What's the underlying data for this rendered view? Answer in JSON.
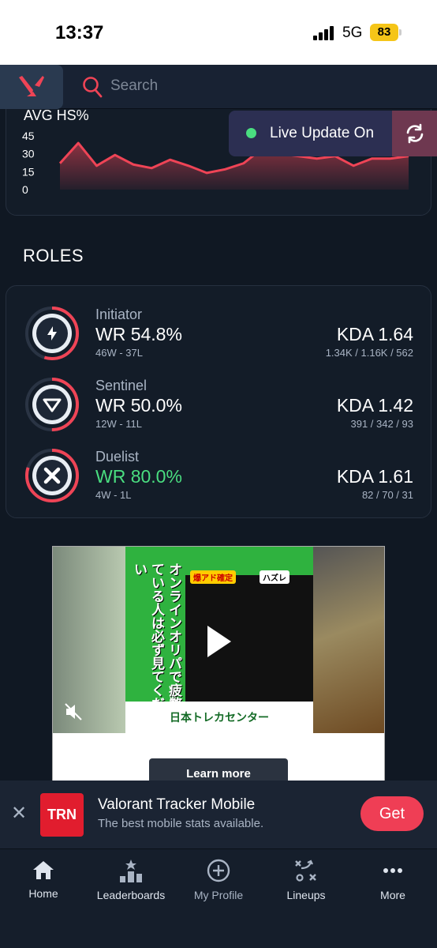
{
  "status_bar": {
    "time": "13:37",
    "network": "5G",
    "battery": "83"
  },
  "header": {
    "search_placeholder": "Search"
  },
  "hs_chart": {
    "title": "AVG HS%",
    "live_update_label": "Live Update On"
  },
  "chart_data": {
    "type": "area",
    "title": "AVG HS%",
    "yticks": [
      45,
      30,
      15,
      0
    ],
    "ylim": [
      0,
      45
    ],
    "values": [
      22,
      39,
      20,
      29,
      21,
      18,
      25,
      20,
      14,
      17,
      22,
      34,
      30,
      28,
      26,
      28,
      20,
      26,
      26,
      28
    ],
    "color": "#ef4456"
  },
  "roles": {
    "heading": "ROLES",
    "items": [
      {
        "name": "Initiator",
        "wr": "WR 54.8%",
        "wl": "46W - 37L",
        "kda": "KDA 1.64",
        "kda_detail": "1.34K / 1.16K / 562",
        "wr_fraction": 0.548,
        "highlight": false
      },
      {
        "name": "Sentinel",
        "wr": "WR 50.0%",
        "wl": "12W - 11L",
        "kda": "KDA 1.42",
        "kda_detail": "391 / 342 / 93",
        "wr_fraction": 0.5,
        "highlight": false
      },
      {
        "name": "Duelist",
        "wr": "WR 80.0%",
        "wl": "4W - 1L",
        "kda": "KDA 1.61",
        "kda_detail": "82 / 70 / 31",
        "wr_fraction": 0.8,
        "highlight": true
      }
    ]
  },
  "ad": {
    "vertical_text": "オンラインオリパで疲弊している人は必ず見てください",
    "label_left": "爆アド確定",
    "label_right": "ハズレ",
    "banner_text": "日本トレカセンター",
    "learn_more": "Learn more"
  },
  "promo": {
    "logo_text": "TRN",
    "title": "Valorant Tracker Mobile",
    "subtitle": "The best mobile stats available.",
    "get_label": "Get"
  },
  "bottom_nav": {
    "items": [
      {
        "label": "Home",
        "icon": "home-icon"
      },
      {
        "label": "Leaderboards",
        "icon": "leaderboards-icon"
      },
      {
        "label": "My Profile",
        "icon": "add-circle-icon"
      },
      {
        "label": "Lineups",
        "icon": "lineups-icon"
      },
      {
        "label": "More",
        "icon": "more-icon"
      }
    ]
  },
  "colors": {
    "accent": "#ef4456",
    "positive": "#4ade80",
    "background": "#101823"
  }
}
